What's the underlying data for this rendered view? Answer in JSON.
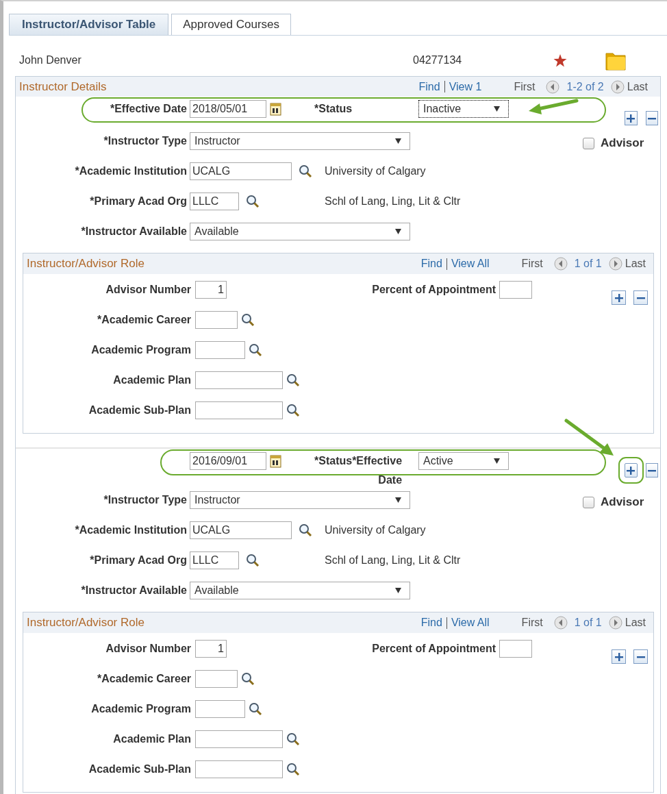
{
  "tabs": [
    {
      "label": "Instructor/Advisor Table",
      "selected": true
    },
    {
      "label": "Approved Courses",
      "selected": false
    }
  ],
  "person": {
    "name": "John Denver",
    "id": "04277134"
  },
  "details": {
    "title": "Instructor Details",
    "find": "Find",
    "view": "View 1",
    "first": "First",
    "range": "1-2 of 2",
    "last": "Last",
    "records": [
      {
        "kind": "normal",
        "date_label": "*Effective Date",
        "date": "2018/05/01",
        "status_label": "*Status",
        "status": "Inactive",
        "status_focused": true,
        "highlight_row": true,
        "highlight_add": false,
        "arrow_to_status": true,
        "arrow_to_add": false,
        "advisor_label": "Advisor",
        "advisor_checked": false,
        "fields": [
          {
            "kind": "select",
            "label": "*Instructor Type",
            "value": "Instructor"
          },
          {
            "kind": "lookup",
            "label": "*Academic Institution",
            "value": "UCALG",
            "description": "University of Calgary"
          },
          {
            "kind": "lookup",
            "label": "*Primary Acad Org",
            "value": "LLLC",
            "description": "Schl of Lang, Ling, Lit & Cltr"
          },
          {
            "kind": "select",
            "label": "*Instructor Available",
            "value": "Available"
          }
        ],
        "role": {
          "title": "Instructor/Advisor Role",
          "find": "Find",
          "view": "View All",
          "first": "First",
          "range": "1 of 1",
          "last": "Last",
          "advisor_number_label": "Advisor Number",
          "advisor_number": "1",
          "percent_label": "Percent of Appointment",
          "fields": [
            {
              "label": "*Academic Career"
            },
            {
              "label": "Academic Program"
            },
            {
              "label": "Academic Plan"
            },
            {
              "label": "Academic Sub-Plan"
            }
          ]
        }
      },
      {
        "kind": "shifted",
        "date_label": "*Effective Date",
        "date": "2016/09/01",
        "status_label": "*Status",
        "status": "Active",
        "status_focused": false,
        "highlight_row": true,
        "highlight_add": true,
        "arrow_to_status": false,
        "arrow_to_add": true,
        "advisor_label": "Advisor",
        "advisor_checked": false,
        "fields": [
          {
            "kind": "select",
            "label": "*Instructor Type",
            "value": "Instructor"
          },
          {
            "kind": "lookup",
            "label": "*Academic Institution",
            "value": "UCALG",
            "description": "University of Calgary"
          },
          {
            "kind": "lookup",
            "label": "*Primary Acad Org",
            "value": "LLLC",
            "description": "Schl of Lang, Ling, Lit & Cltr"
          },
          {
            "kind": "select",
            "label": "*Instructor Available",
            "value": "Available"
          }
        ],
        "role": {
          "title": "Instructor/Advisor Role",
          "find": "Find",
          "view": "View All",
          "first": "First",
          "range": "1 of 1",
          "last": "Last",
          "advisor_number_label": "Advisor Number",
          "advisor_number": "1",
          "percent_label": "Percent of Appointment",
          "fields": [
            {
              "label": "*Academic Career"
            },
            {
              "label": "Academic Program"
            },
            {
              "label": "Academic Plan"
            },
            {
              "label": "Academic Sub-Plan"
            }
          ]
        }
      }
    ]
  }
}
